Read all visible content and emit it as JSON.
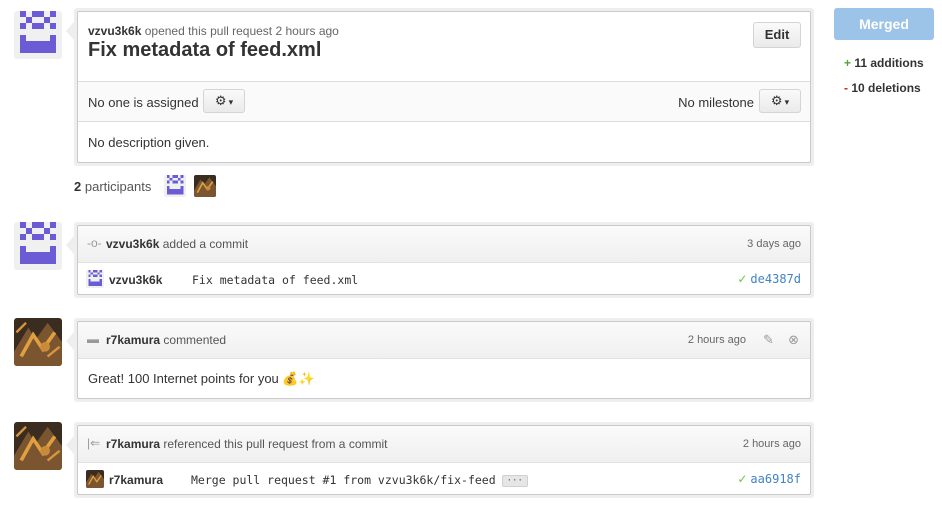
{
  "pull_request": {
    "author": "vzvu3k6k",
    "opened_text": "opened this pull request 2 hours ago",
    "title": "Fix metadata of feed.xml",
    "edit_label": "Edit",
    "assignee_text": "No one is assigned",
    "milestone_text": "No milestone",
    "description": "No description given.",
    "gear_icon": "⚙",
    "caret_icon": "▾"
  },
  "participants": {
    "count": "2",
    "label": "participants"
  },
  "timeline": {
    "commit_event": {
      "user": "vzvu3k6k",
      "action": "added a commit",
      "time": "3 days ago",
      "commit_author": "vzvu3k6k",
      "commit_message": "Fix metadata of feed.xml",
      "sha": "de4387d",
      "check_icon": "✓",
      "icon": "commit-icon"
    },
    "comment_event": {
      "user": "r7kamura",
      "action": "commented",
      "time": "2 hours ago",
      "body": "Great! 100 Internet points for you",
      "emoji": "💰✨",
      "edit_icon": "✎",
      "delete_icon": "⊗"
    },
    "reference_event": {
      "user": "r7kamura",
      "action": "referenced this pull request from a commit",
      "time": "2 hours ago",
      "commit_author": "r7kamura",
      "commit_message": "Merge pull request #1 from vzvu3k6k/fix-feed",
      "ellipsis": "···",
      "sha": "aa6918f",
      "check_icon": "✓"
    }
  },
  "sidebar": {
    "status_label": "Merged",
    "additions_sign": "+",
    "additions": "11 additions",
    "deletions_sign": "-",
    "deletions": "10 deletions",
    "status_color": "#9cc3e8",
    "additions_color": "#55a532",
    "deletions_color": "#bd2c00"
  }
}
